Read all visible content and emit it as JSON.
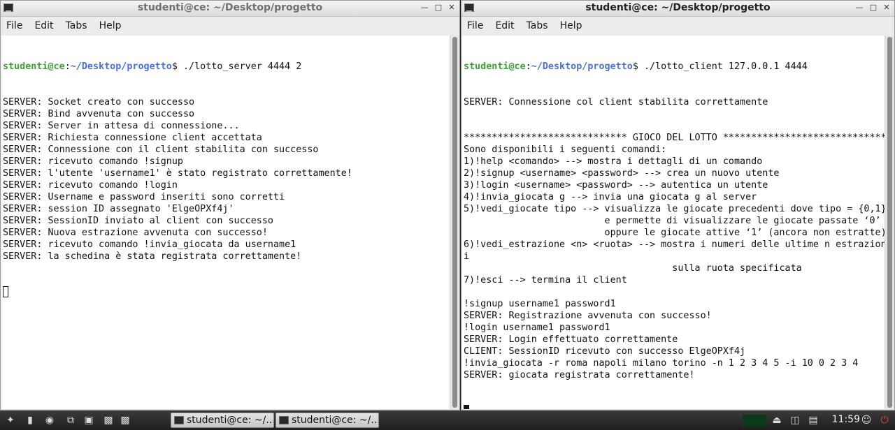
{
  "windows": [
    {
      "title": "studenti@ce: ~/Desktop/progetto",
      "menu": [
        "File",
        "Edit",
        "Tabs",
        "Help"
      ],
      "prompt": {
        "user": "studenti@ce",
        "sep": ":",
        "path": "~/Desktop/progetto",
        "sym": "$",
        "command": " ./lotto_server 4444 2"
      },
      "lines": [
        "SERVER: Socket creato con successo",
        "SERVER: Bind avvenuta con successo",
        "SERVER: Server in attesa di connessione...",
        "SERVER: Richiesta connessione client accettata",
        "SERVER: Connessione con il client stabilita con successo",
        "SERVER: ricevuto comando !signup",
        "SERVER: l'utente 'username1' è stato registrato correttamente!",
        "SERVER: ricevuto comando !login",
        "SERVER: Username e password inseriti sono corretti",
        "SERVER: session ID assegnato 'ElgeOPXf4j'",
        "SERVER: SessionID inviato al client con successo",
        "SERVER: Nuova estrazione avvenuta con successo!",
        "SERVER: ricevuto comando !invia_giocata da username1",
        "SERVER: la schedina è stata registrata correttamente!"
      ]
    },
    {
      "title": "studenti@ce: ~/Desktop/progetto",
      "menu": [
        "File",
        "Edit",
        "Tabs",
        "Help"
      ],
      "prompt": {
        "user": "studenti@ce",
        "sep": ":",
        "path": "~/Desktop/progetto",
        "sym": "$",
        "command": " ./lotto_client 127.0.0.1 4444"
      },
      "lines": [
        "SERVER: Connessione col client stabilita correttamente",
        "",
        "",
        "***************************** GIOCO DEL LOTTO *****************************",
        "Sono disponibili i seguenti comandi:",
        "1)!help <comando> --> mostra i dettagli di un comando",
        "2)!signup <username> <password> --> crea un nuovo utente",
        "3)!login <username> <password> --> autentica un utente",
        "4)!invia_giocata g --> invia una giocata g al server",
        "5)!vedi_giocate tipo --> visualizza le giocate precedenti dove tipo = {0,1}",
        "                         e permette di visualizzare le giocate passate ‘0’",
        "                         oppure le giocate attive ‘1’ (ancora non estratte)",
        "6)!vedi_estrazione <n> <ruota> --> mostra i numeri delle ultime n estrazion",
        "i",
        "                                     sulla ruota specificata",
        "7)!esci --> termina il client",
        "",
        "!signup username1 password1",
        "SERVER: Registrazione avvenuta con successo!",
        "!login username1 password1",
        "SERVER: Login effettuato correttamente",
        "CLIENT: SessionID ricevuto con successo ElgeOPXf4j",
        "!invia_giocata -r roma napoli milano torino -n 1 2 3 4 5 -i 10 0 2 3 4",
        "SERVER: giocata registrata correttamente!"
      ]
    }
  ],
  "taskbar": {
    "tasks": [
      "studenti@ce: ~/...",
      "studenti@ce: ~/..."
    ],
    "clock": "11:59"
  }
}
